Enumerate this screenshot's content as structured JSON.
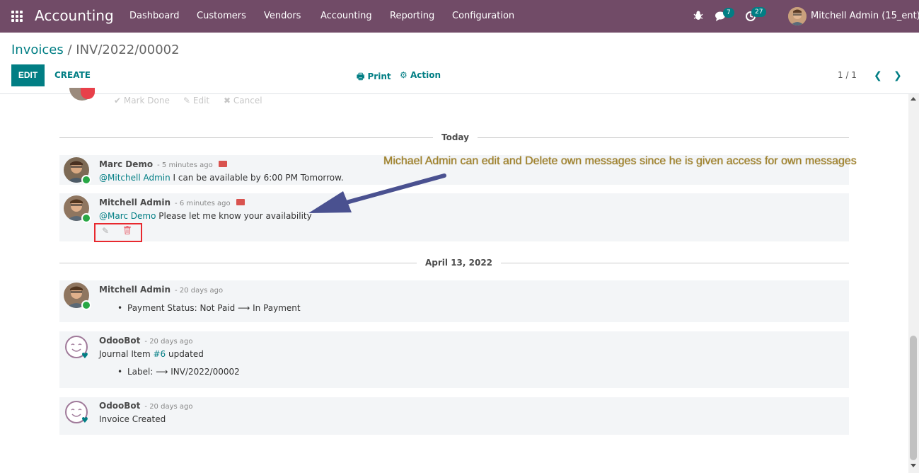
{
  "app": {
    "title": "Accounting"
  },
  "nav": {
    "menus": [
      "Dashboard",
      "Customers",
      "Vendors",
      "Accounting",
      "Reporting",
      "Configuration"
    ],
    "messages_count": "7",
    "activities_count": "27",
    "user": "Mitchell Admin (15_ent)"
  },
  "breadcrumb": {
    "parent": "Invoices",
    "separator": "/",
    "current": "INV/2022/00002"
  },
  "toolbar": {
    "edit_label": "EDIT",
    "create_label": "CREATE",
    "print_label": "Print",
    "action_label": "Action",
    "pager": "1 / 1"
  },
  "activity_actions": {
    "mark_done": "Mark Done",
    "edit": "Edit",
    "cancel": "Cancel"
  },
  "annotation": "Michael Admin can edit and Delete own messages since he is given access for own messages",
  "sections": [
    {
      "date": "Today",
      "messages": [
        {
          "author": "Marc Demo",
          "date": "- 5 minutes ago",
          "mention": "@Mitchell Admin",
          "text": " I can be available by 6:00 PM Tomorrow."
        },
        {
          "author": "Mitchell Admin",
          "date": "- 6 minutes ago",
          "mention": "@Marc Demo",
          "text": " Please let me know your availability"
        }
      ]
    },
    {
      "date": "April 13, 2022",
      "messages": [
        {
          "author": "Mitchell Admin",
          "date": "- 20 days ago",
          "item": "Payment Status: Not Paid ⟶ In Payment"
        },
        {
          "author": "OdooBot",
          "date": "- 20 days ago",
          "text_before": "Journal Item ",
          "link": "#6",
          "text_after": " updated",
          "item": "Label: ⟶ INV/2022/00002"
        },
        {
          "author": "OdooBot",
          "date": "- 20 days ago",
          "text": "Invoice Created"
        }
      ]
    }
  ],
  "colors": {
    "brand": "#714B67",
    "accent": "#017e84",
    "highlight_box": "#e8282e",
    "annotation_arrow": "#4a5190"
  }
}
